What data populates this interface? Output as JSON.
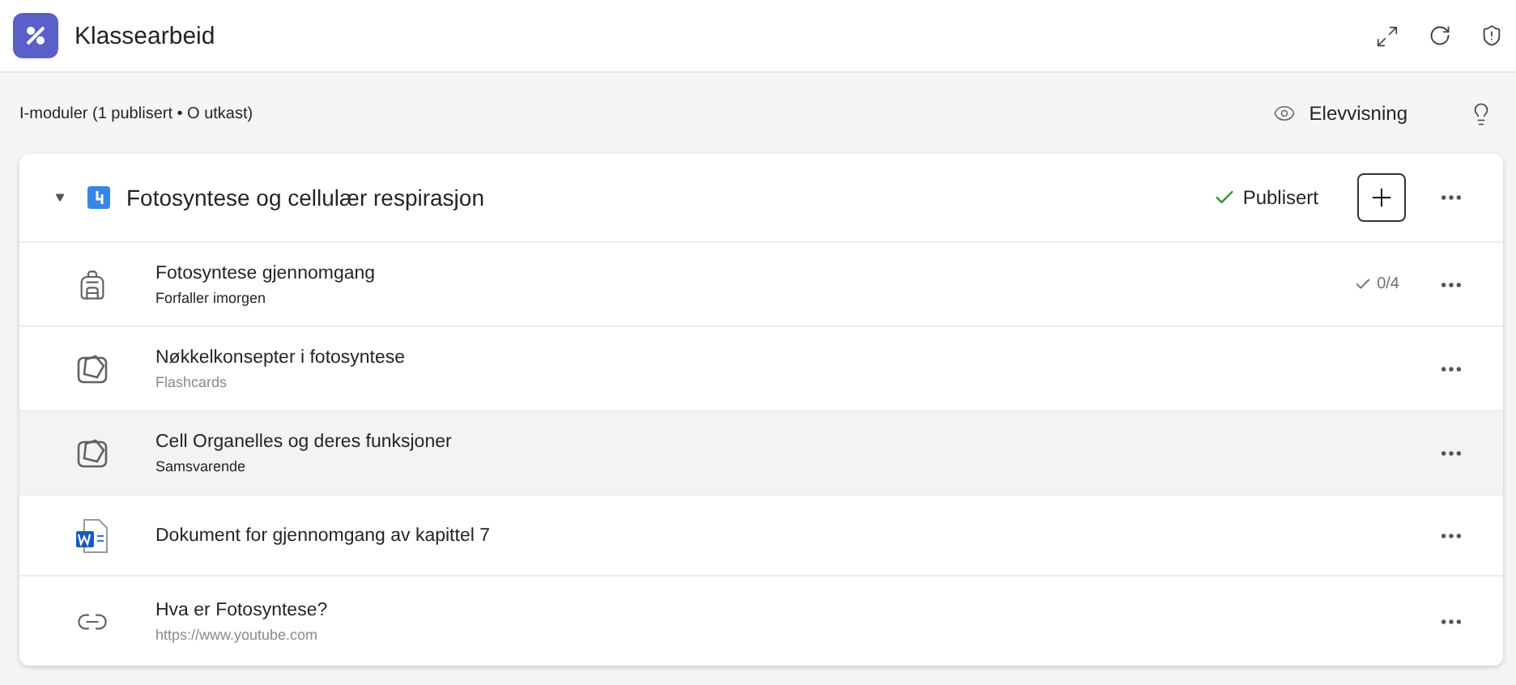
{
  "app": {
    "title": "Klassearbeid"
  },
  "summary": "I-moduler (1 publisert • O utkast)",
  "student_view": {
    "label": "Elevvisning"
  },
  "module": {
    "title": "Fotosyntese og cellulær respirasjon",
    "expanded": true,
    "status": "Publisert",
    "published": true,
    "items": [
      {
        "kind": "assignment",
        "title": "Fotosyntese gjennomgang",
        "subtitle": "Forfaller imorgen",
        "muted": false,
        "progress": "0/4",
        "selected": false
      },
      {
        "kind": "flashcards",
        "title": "Nøkkelkonsepter i fotosyntese",
        "subtitle": "Flashcards",
        "muted": true,
        "selected": false
      },
      {
        "kind": "matching",
        "title": "Cell Organelles og deres funksjoner",
        "subtitle": "Samsvarende",
        "muted": false,
        "selected": true
      },
      {
        "kind": "document",
        "title": "Dokument for gjennomgang av kapittel 7",
        "selected": false
      },
      {
        "kind": "link",
        "title": "Hva er Fotosyntese?",
        "subtitle": "https://www.youtube.com",
        "muted": true,
        "selected": false
      }
    ]
  }
}
